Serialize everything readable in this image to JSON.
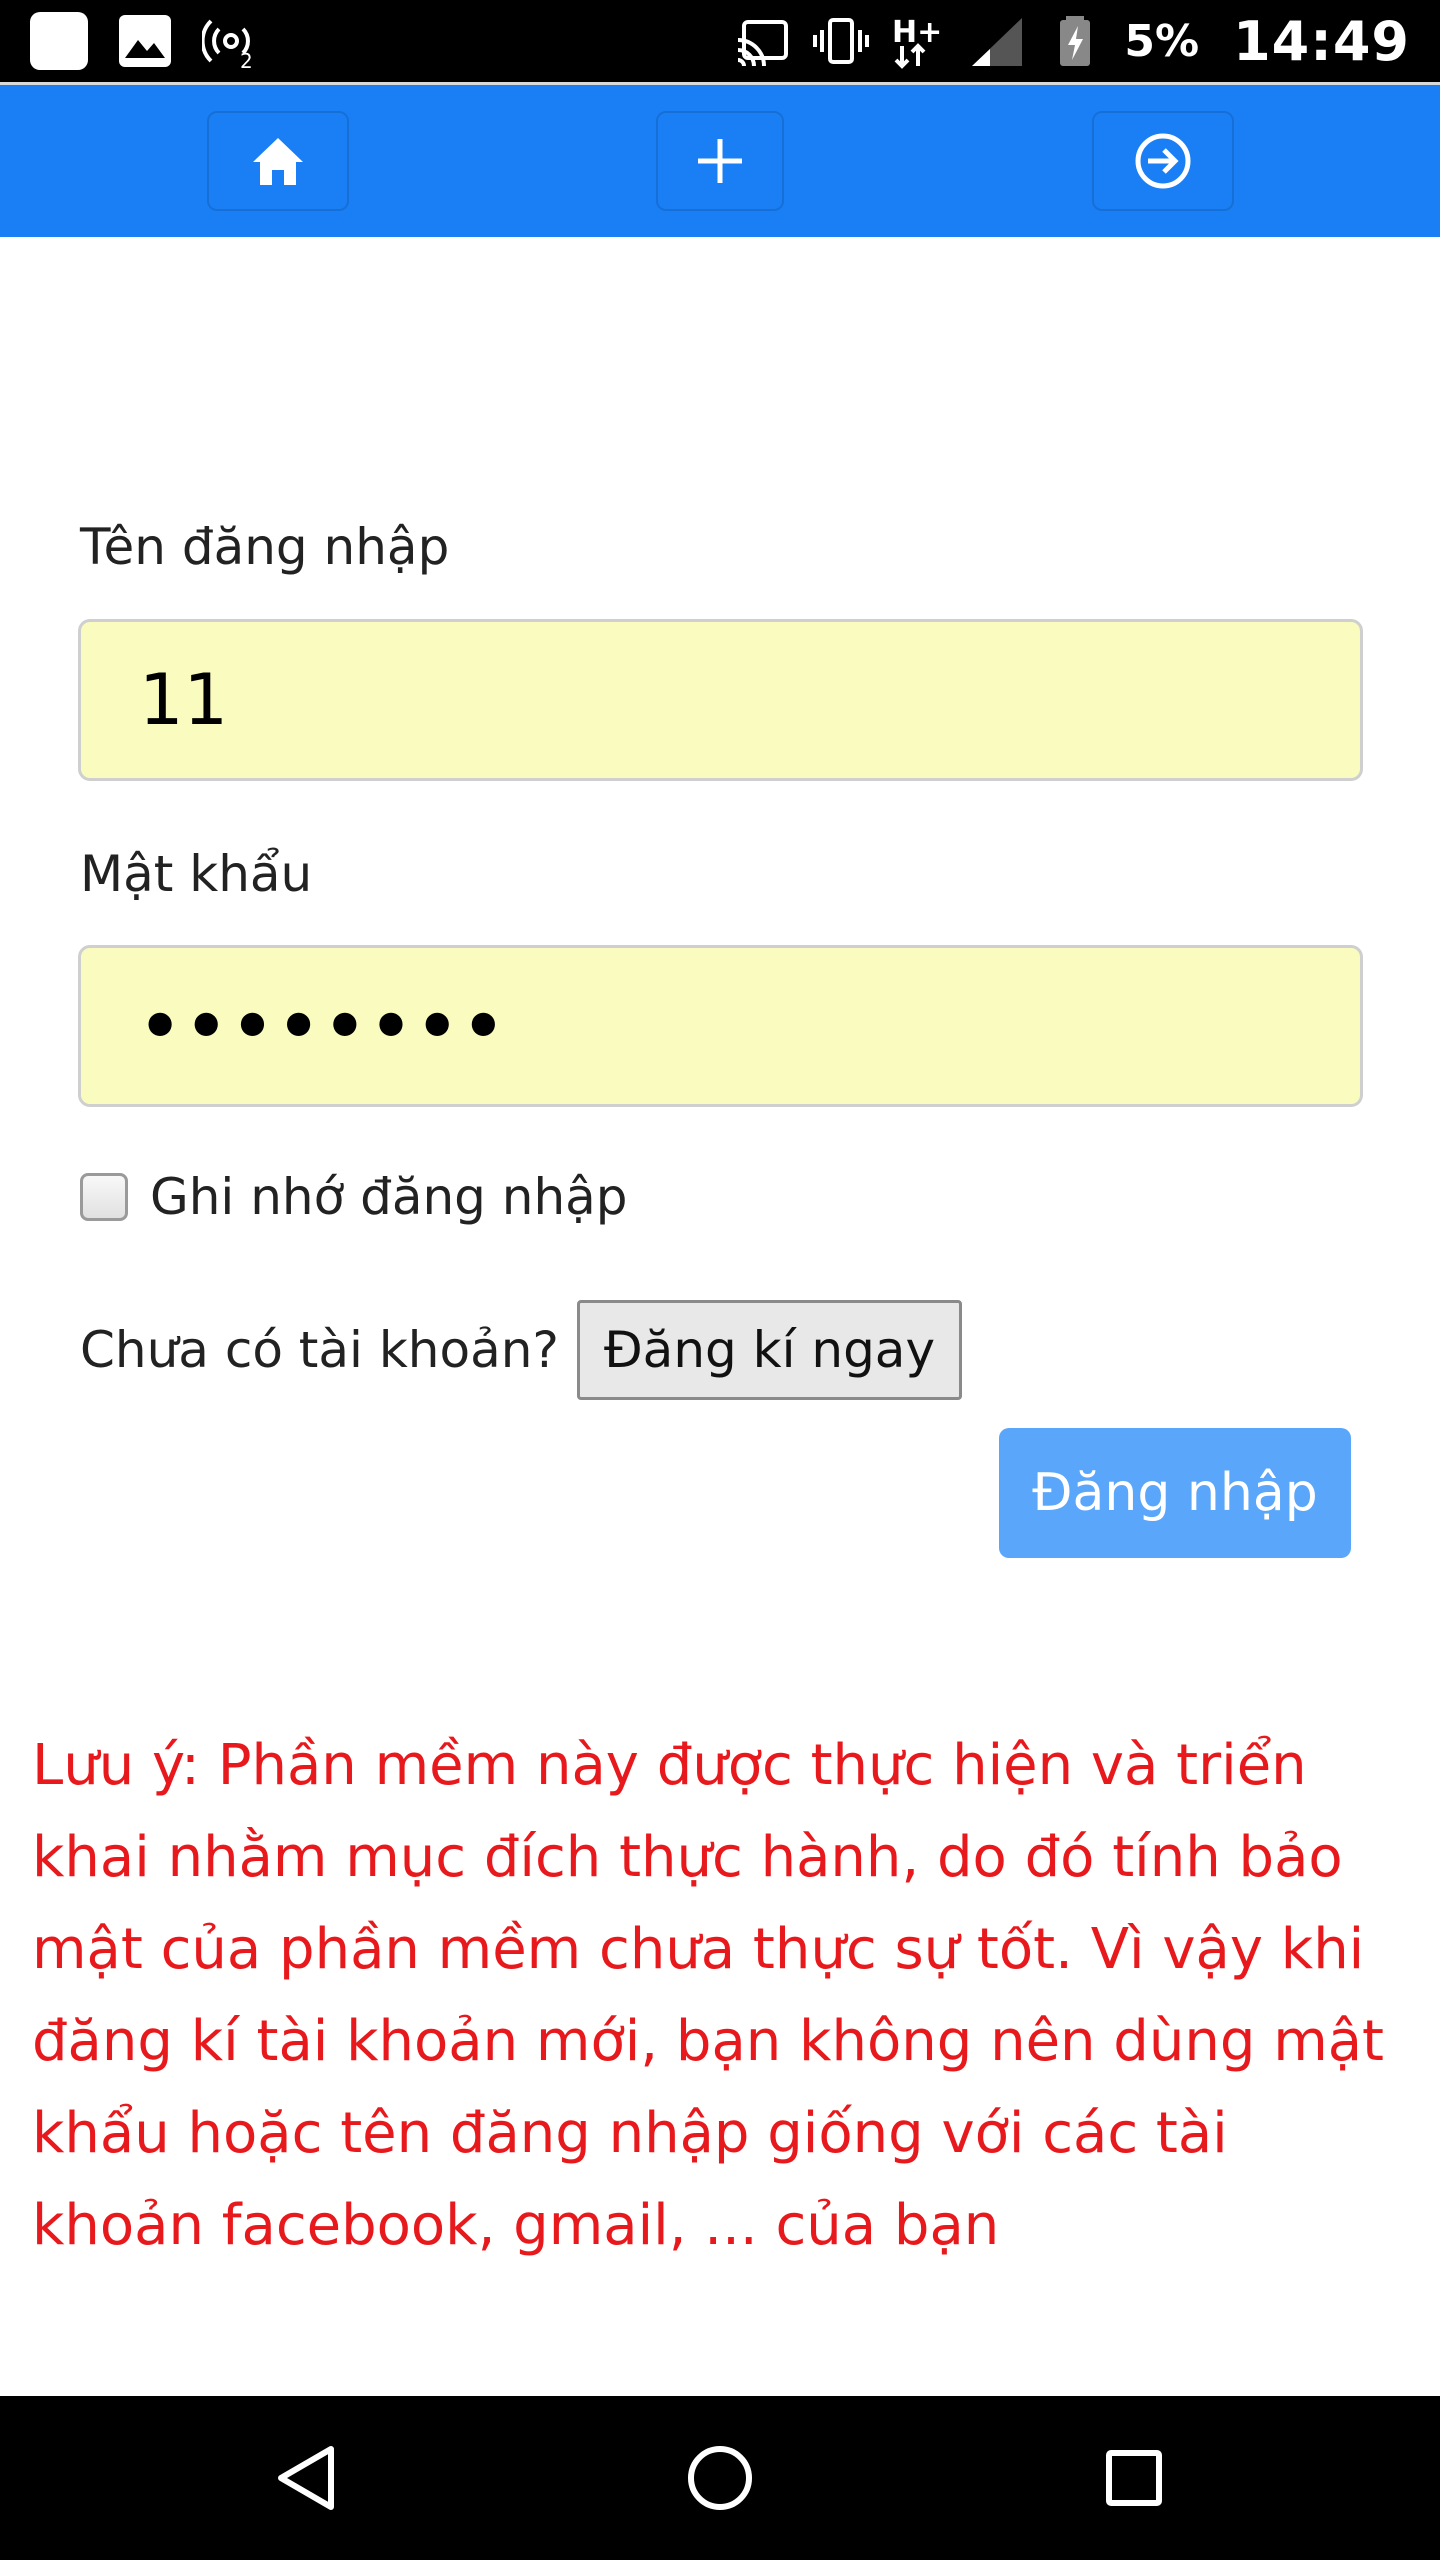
{
  "status_bar": {
    "battery_percent": "5%",
    "time": "14:49",
    "network_type": "H+",
    "left_icons": [
      "app-notification-icon",
      "image-icon",
      "hotspot-icon"
    ],
    "right_icons": [
      "cast-icon",
      "vibrate-icon",
      "data-arrows-icon",
      "signal-icon",
      "battery-icon"
    ]
  },
  "topnav": {
    "accent_color": "#1a7ff5",
    "icons": [
      "home-icon",
      "plus-icon",
      "login-icon"
    ]
  },
  "form": {
    "username_label": "Tên đăng nhập",
    "username_value": "11",
    "password_label": "Mật khẩu",
    "password_value": "••••••••",
    "remember_label": "Ghi nhớ đăng nhập",
    "remember_checked": false,
    "no_account_text": "Chưa có tài khoản?",
    "register_button": "Đăng kí ngay",
    "login_button": "Đăng nhập",
    "field_bg_color": "#fafcbf",
    "login_button_color": "#5aa6fb"
  },
  "notice": {
    "text": "Lưu ý: Phần mềm này được thực hiện và triển khai nhằm mục đích thực hành, do đó tính bảo mật của phần mềm chưa thực sự tốt. Vì vậy khi đăng kí tài khoản mới, bạn không nên dùng mật khẩu hoặc tên đăng nhập giống với các tài khoản facebook, gmail, ... của bạn",
    "color": "#e8191c"
  },
  "system_nav": {
    "icons": [
      "back-icon",
      "home-circle-icon",
      "recent-apps-icon"
    ]
  }
}
